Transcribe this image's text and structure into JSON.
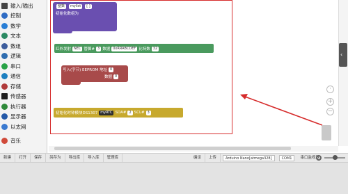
{
  "sidebar": {
    "items": [
      {
        "label": "输入/输出",
        "icon": "io-icon",
        "color": "#444444"
      },
      {
        "label": "控制",
        "icon": "control-icon",
        "color": "#2f6cc4"
      },
      {
        "label": "数学",
        "icon": "math-icon",
        "color": "#2a7fd6"
      },
      {
        "label": "文本",
        "icon": "text-icon",
        "color": "#2b8a63"
      },
      {
        "label": "数组",
        "icon": "array-icon",
        "color": "#3c5c9c"
      },
      {
        "label": "逻辑",
        "icon": "logic-icon",
        "color": "#2f6db0"
      },
      {
        "label": "串口",
        "icon": "serial-icon",
        "color": "#29a347"
      },
      {
        "label": "通信",
        "icon": "communication-icon",
        "color": "#1d7fc0"
      },
      {
        "label": "存储",
        "icon": "storage-icon",
        "color": "#b03a3a"
      },
      {
        "label": "传感器",
        "icon": "sensor-icon",
        "color": "#1c1c1c"
      },
      {
        "label": "执行器",
        "icon": "actuator-icon",
        "color": "#2f8a3a"
      },
      {
        "label": "显示器",
        "icon": "display-icon",
        "color": "#2459a8"
      },
      {
        "label": "以太网",
        "icon": "ethernet-icon",
        "color": "#3b7ad0"
      },
      {
        "label": "音乐",
        "icon": "music-icon",
        "color": "#d04a3a"
      }
    ]
  },
  "blocks": {
    "top": {
      "label": "初始化数组为",
      "dropdown": "整数",
      "name": "mylist",
      "bracket": "[ ]"
    },
    "ir": {
      "prefix": "红外发射",
      "type": "NEC",
      "pin_label": "管脚#",
      "pin": "3",
      "data_label": "数据",
      "data": "0xRRABCDEF",
      "bits_label": "比特数",
      "bits": "32"
    },
    "eeprom": {
      "label": "写入(字节) EEPROM 地址",
      "addr": "0",
      "data_label": "数据",
      "data": "0"
    },
    "rtc": {
      "label": "初始化时钟模块DS1307",
      "name": "myRTC",
      "sda_label": "SDA#",
      "sda": "2",
      "scl_label": "SCL#",
      "scl": "3"
    }
  },
  "toolbar": {
    "buttons": [
      "新建",
      "打开",
      "保存",
      "另存为",
      "导出库",
      "导入库",
      "管理库"
    ],
    "compile": "编译",
    "upload": "上传",
    "board": "Arduino Nano[atmega328]",
    "port": "COM1",
    "serial_monitor": "串口监视器"
  },
  "colors": {
    "accent": "#d62b2b",
    "ir_block": "#4a9a5e",
    "eeprom_block": "#a84a4a",
    "rtc_block": "#c7a92e",
    "array_block": "#6a4fb0"
  }
}
